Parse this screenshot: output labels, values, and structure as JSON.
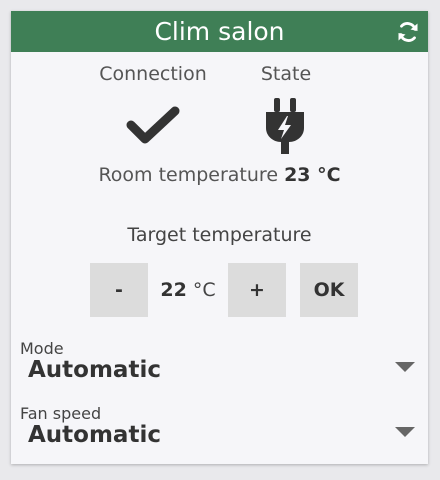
{
  "header": {
    "title": "Clim salon",
    "refresh_icon": "refresh-icon",
    "color": "#3f7f56"
  },
  "status": {
    "connection_label": "Connection",
    "connection_icon": "checkmark-icon",
    "state_label": "State",
    "state_icon": "plug-icon"
  },
  "room": {
    "label": "Room temperature",
    "value": "23 °C"
  },
  "target": {
    "label": "Target temperature",
    "minus_label": "-",
    "value": "22",
    "unit": "°C",
    "plus_label": "+",
    "ok_label": "OK"
  },
  "mode": {
    "label": "Mode",
    "value": "Automatic"
  },
  "fan_speed": {
    "label": "Fan speed",
    "value": "Automatic"
  }
}
